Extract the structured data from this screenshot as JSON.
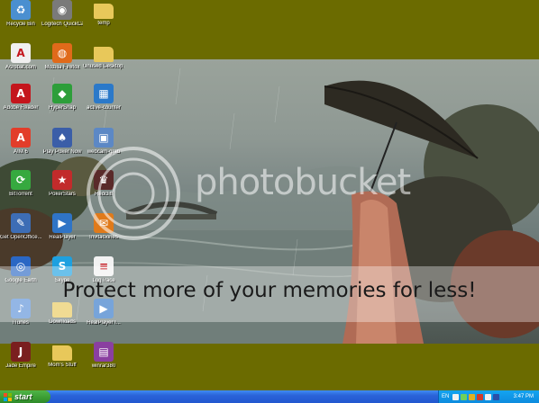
{
  "desktop": {
    "icons": [
      {
        "label": "Recycle Bin",
        "icon": "recycle-bin-icon",
        "glyph": "♻",
        "color": "#4a8fd0"
      },
      {
        "label": "Logitech QuickCam",
        "icon": "webcam-icon",
        "glyph": "◉",
        "color": "#7a7a7a"
      },
      {
        "label": "temp",
        "icon": "folder-icon",
        "glyph": "",
        "color": "#e8c85a"
      },
      {
        "label": "Acrobat.com",
        "icon": "acrobat-icon",
        "glyph": "A",
        "color": "#f0f0f0"
      },
      {
        "label": "Mozilla Firefox",
        "icon": "firefox-icon",
        "glyph": "◍",
        "color": "#e06a1a"
      },
      {
        "label": "Unused Desktop...",
        "icon": "folder-icon",
        "glyph": "",
        "color": "#e8c85a"
      },
      {
        "label": "Adobe Reader",
        "icon": "adobe-reader-icon",
        "glyph": "A",
        "color": "#c4151c"
      },
      {
        "label": "HyperSnap",
        "icon": "hypersnap-icon",
        "glyph": "◆",
        "color": "#2d9e3a"
      },
      {
        "label": "active-counter",
        "icon": "counter-icon",
        "glyph": "▦",
        "color": "#2b79c9"
      },
      {
        "label": "AIM 6",
        "icon": "aim-icon",
        "glyph": "A",
        "color": "#e23d2a"
      },
      {
        "label": "Play Poker Now",
        "icon": "poker-icon",
        "glyph": "♠",
        "color": "#3b5ea8"
      },
      {
        "label": "webcam-grab",
        "icon": "grab-icon",
        "glyph": "▣",
        "color": "#5c88c5"
      },
      {
        "label": "BitTorrent",
        "icon": "bittorrent-icon",
        "glyph": "⟳",
        "color": "#36a93f"
      },
      {
        "label": "PokerStars",
        "icon": "pokerstars-icon",
        "glyph": "★",
        "color": "#c22b2b"
      },
      {
        "label": "Redcliff",
        "icon": "redcliff-icon",
        "glyph": "♛",
        "color": "#5a2a2a"
      },
      {
        "label": "Get OpenOffice...",
        "icon": "openoffice-icon",
        "glyph": "✎",
        "color": "#3d6db5"
      },
      {
        "label": "RealPlayer",
        "icon": "realplayer-icon",
        "glyph": "▶",
        "color": "#2f74c6"
      },
      {
        "label": "Invitaciones",
        "icon": "invitation-icon",
        "glyph": "✉",
        "color": "#e07a1a"
      },
      {
        "label": "Google Earth",
        "icon": "google-earth-icon",
        "glyph": "◎",
        "color": "#2a67c4"
      },
      {
        "label": "Skype",
        "icon": "skype-icon",
        "glyph": "S",
        "color": "#1da0e0"
      },
      {
        "label": "LogTrace",
        "icon": "document-icon",
        "glyph": "≡",
        "color": "#f2f2f2"
      },
      {
        "label": "iTunes",
        "icon": "itunes-icon",
        "glyph": "♪",
        "color": "#5a8fd8"
      },
      {
        "label": "Downloads",
        "icon": "folder-icon",
        "glyph": "",
        "color": "#e8c85a"
      },
      {
        "label": "RealPlayer I...",
        "icon": "realplayer-icon",
        "glyph": "▶",
        "color": "#2f74c6"
      },
      {
        "label": "Jade Empire",
        "icon": "jade-empire-icon",
        "glyph": "J",
        "color": "#7a1f1f"
      },
      {
        "label": "Mom's Stuff",
        "icon": "folder-icon",
        "glyph": "",
        "color": "#e8c85a"
      },
      {
        "label": "winrar380",
        "icon": "winrar-icon",
        "glyph": "▤",
        "color": "#8a3fa0"
      }
    ]
  },
  "watermark": {
    "brand": "photobucket",
    "banner": "Protect more of your memories for less!"
  },
  "taskbar": {
    "start_label": "start",
    "language": "EN",
    "clock": "3:47 PM",
    "colors": {
      "bar": "#2a63d8",
      "start": "#3a9b32",
      "tray": "#0d8bde"
    }
  }
}
